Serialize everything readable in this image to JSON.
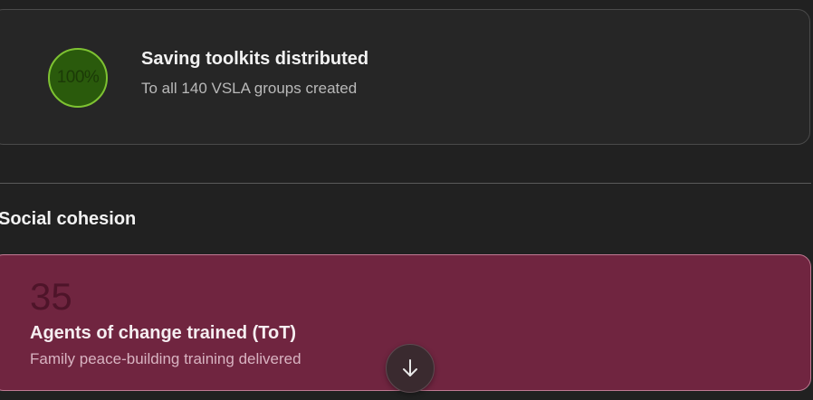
{
  "top_card": {
    "percent_label": "100%",
    "title": "Saving toolkits distributed",
    "subtitle": "To all 140 VSLA groups created",
    "accent_color": "#7ec232"
  },
  "section": {
    "heading": "Social cohesion"
  },
  "bottom_card": {
    "number": "35",
    "title": "Agents of change trained (ToT)",
    "subtitle": "Family peace-building training delivered",
    "bg_color": "#702540"
  },
  "scroll_button": {
    "icon": "arrow-down-icon"
  }
}
